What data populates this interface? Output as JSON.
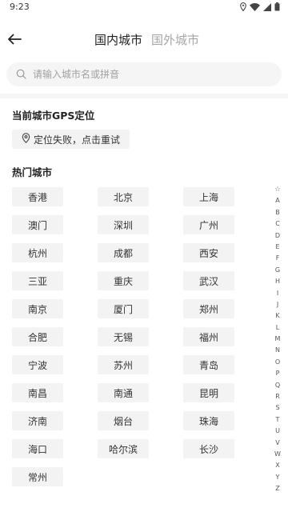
{
  "status_bar": {
    "time": "9:23",
    "icons": [
      "location-icon",
      "wifi-icon",
      "signal-icon",
      "battery-icon"
    ]
  },
  "header": {
    "back_icon": "arrow-left-icon",
    "tabs": [
      {
        "label": "国内城市",
        "active": true
      },
      {
        "label": "国外城市",
        "active": false
      }
    ]
  },
  "search": {
    "placeholder": "请输入城市名或拼音",
    "value": "",
    "icon": "search-icon"
  },
  "gps": {
    "title": "当前城市GPS定位",
    "status": "定位失败，点击重试",
    "icon": "location-pin-icon"
  },
  "hot": {
    "title": "热门城市",
    "cities": [
      "香港",
      "北京",
      "上海",
      "澳门",
      "深圳",
      "广州",
      "杭州",
      "成都",
      "西安",
      "三亚",
      "重庆",
      "武汉",
      "南京",
      "厦门",
      "郑州",
      "合肥",
      "无锡",
      "福州",
      "宁波",
      "苏州",
      "青岛",
      "南昌",
      "南通",
      "昆明",
      "济南",
      "烟台",
      "珠海",
      "海口",
      "哈尔滨",
      "长沙",
      "常州"
    ]
  },
  "index_bar": {
    "star": "☆",
    "letters": [
      "A",
      "B",
      "C",
      "D",
      "E",
      "F",
      "G",
      "H",
      "I",
      "J",
      "K",
      "L",
      "M",
      "N",
      "O",
      "P",
      "Q",
      "R",
      "S",
      "T",
      "U",
      "V",
      "W",
      "X",
      "Y",
      "Z"
    ]
  },
  "colors": {
    "chip_bg": "#f3f3f3",
    "inactive_tab": "#a6a6a6",
    "search_bg": "#f5f5f5"
  }
}
